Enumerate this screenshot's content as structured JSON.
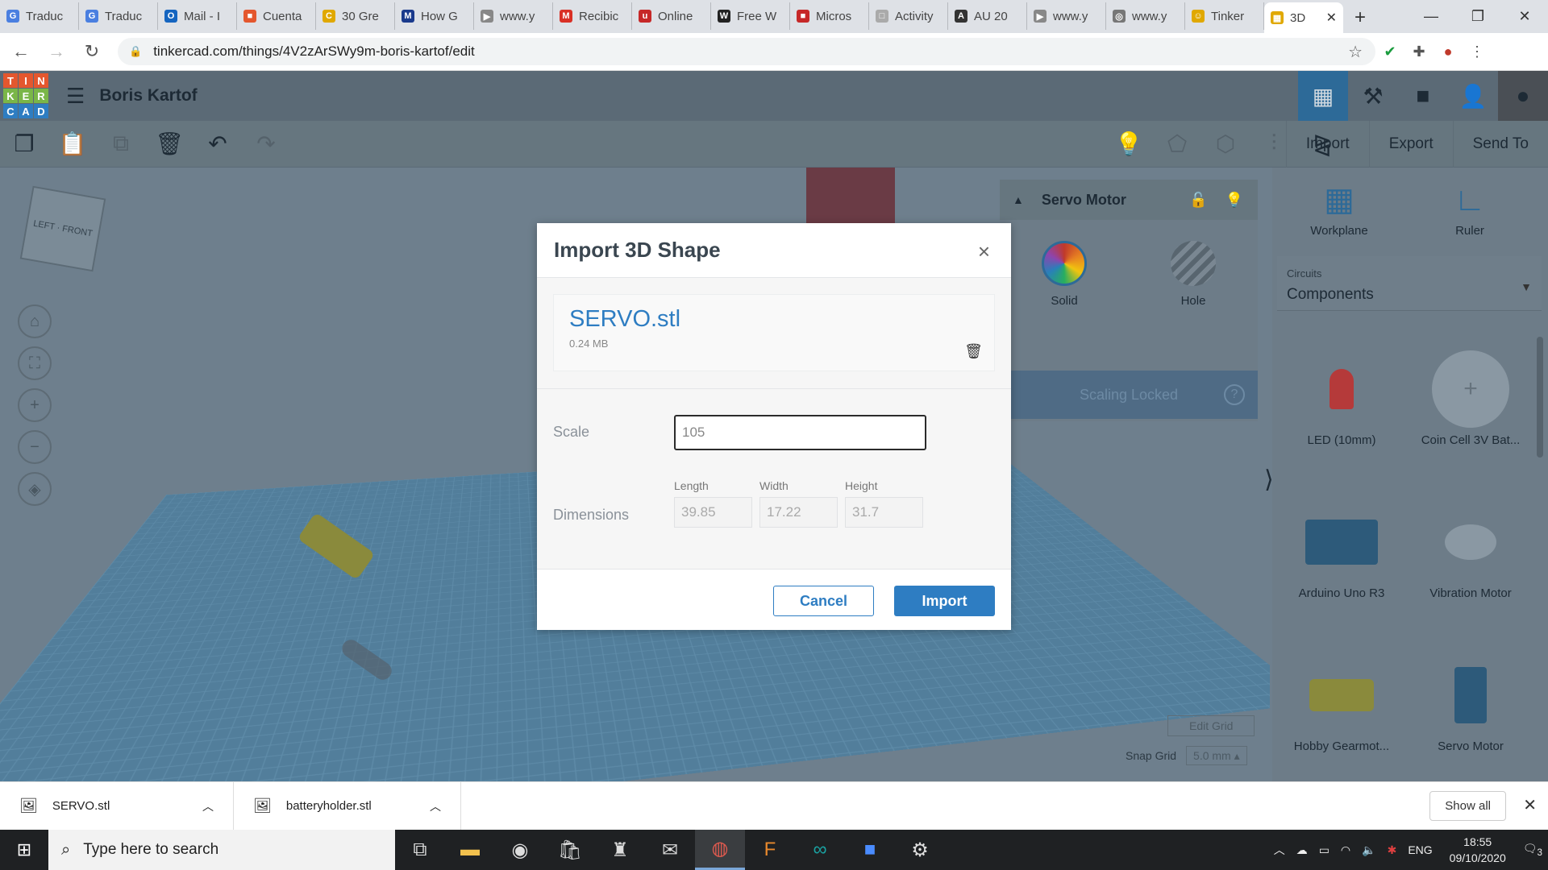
{
  "browser": {
    "tabs": [
      {
        "label": "Traduc",
        "color": "#4a7fe0",
        "glyph": "G"
      },
      {
        "label": "Traduc",
        "color": "#4a7fe0",
        "glyph": "G"
      },
      {
        "label": "Mail - I",
        "color": "#1565c0",
        "glyph": "O"
      },
      {
        "label": "Cuenta",
        "color": "#e4572e",
        "glyph": "■"
      },
      {
        "label": "30 Gre",
        "color": "#e0a800",
        "glyph": "C"
      },
      {
        "label": "How G",
        "color": "#1a3a8c",
        "glyph": "M"
      },
      {
        "label": "www.y",
        "color": "#888888",
        "glyph": "▶"
      },
      {
        "label": "Recibic",
        "color": "#d93025",
        "glyph": "M"
      },
      {
        "label": "Online",
        "color": "#c62828",
        "glyph": "u"
      },
      {
        "label": "Free W",
        "color": "#222222",
        "glyph": "W"
      },
      {
        "label": "Micros",
        "color": "#c62828",
        "glyph": "■"
      },
      {
        "label": "Activity",
        "color": "#aaaaaa",
        "glyph": "□"
      },
      {
        "label": "AU 20",
        "color": "#333333",
        "glyph": "A"
      },
      {
        "label": "www.y",
        "color": "#888888",
        "glyph": "▶"
      },
      {
        "label": "www.y",
        "color": "#777777",
        "glyph": "◎"
      },
      {
        "label": "Tinker",
        "color": "#e0a800",
        "glyph": "☺"
      }
    ],
    "active_tab": {
      "label": "3D",
      "close": "✕"
    },
    "new_tab": "+",
    "url": "tinkercad.com/things/4V2zArSWy9m-boris-kartof/edit"
  },
  "tinkercad": {
    "logo": [
      "T",
      "I",
      "N",
      "K",
      "E",
      "R",
      "C",
      "A",
      "D"
    ],
    "logo_colors": [
      "#e4572e",
      "#e4572e",
      "#e4572e",
      "#7ab648",
      "#7ab648",
      "#7ab648",
      "#2e7dc2",
      "#2e7dc2",
      "#2e7dc2"
    ],
    "project_name": "Boris Kartof",
    "toolbar_right": [
      "Import",
      "Export",
      "Send To"
    ],
    "inspector": {
      "title": "Servo Motor",
      "solid_label": "Solid",
      "hole_label": "Hole",
      "scaling_locked": "Scaling Locked",
      "help": "?"
    },
    "edit_grid": "Edit Grid",
    "snap_grid_label": "Snap Grid",
    "snap_grid_value": "5.0 mm ▴",
    "panel": {
      "workplane": "Workplane",
      "ruler": "Ruler",
      "category_small": "Circuits",
      "category": "Components",
      "parts": [
        "LED (10mm)",
        "Coin Cell 3V Bat...",
        "Arduino Uno R3",
        "Vibration Motor",
        "Hobby Gearmot...",
        "Servo Motor"
      ]
    }
  },
  "modal": {
    "title": "Import 3D Shape",
    "close": "×",
    "file_name": "SERVO.stl",
    "file_size": "0.24 MB",
    "scale_label": "Scale",
    "scale_value": "105",
    "dimensions_label": "Dimensions",
    "length_label": "Length",
    "width_label": "Width",
    "height_label": "Height",
    "length": "39.85",
    "width": "17.22",
    "height": "31.7",
    "cancel": "Cancel",
    "import": "Import"
  },
  "downloads": {
    "items": [
      "SERVO.stl",
      "batteryholder.stl"
    ],
    "show_all": "Show all"
  },
  "taskbar": {
    "search_placeholder": "Type here to search",
    "lang": "ENG",
    "time": "18:55",
    "date": "09/10/2020",
    "notifications": "3"
  }
}
